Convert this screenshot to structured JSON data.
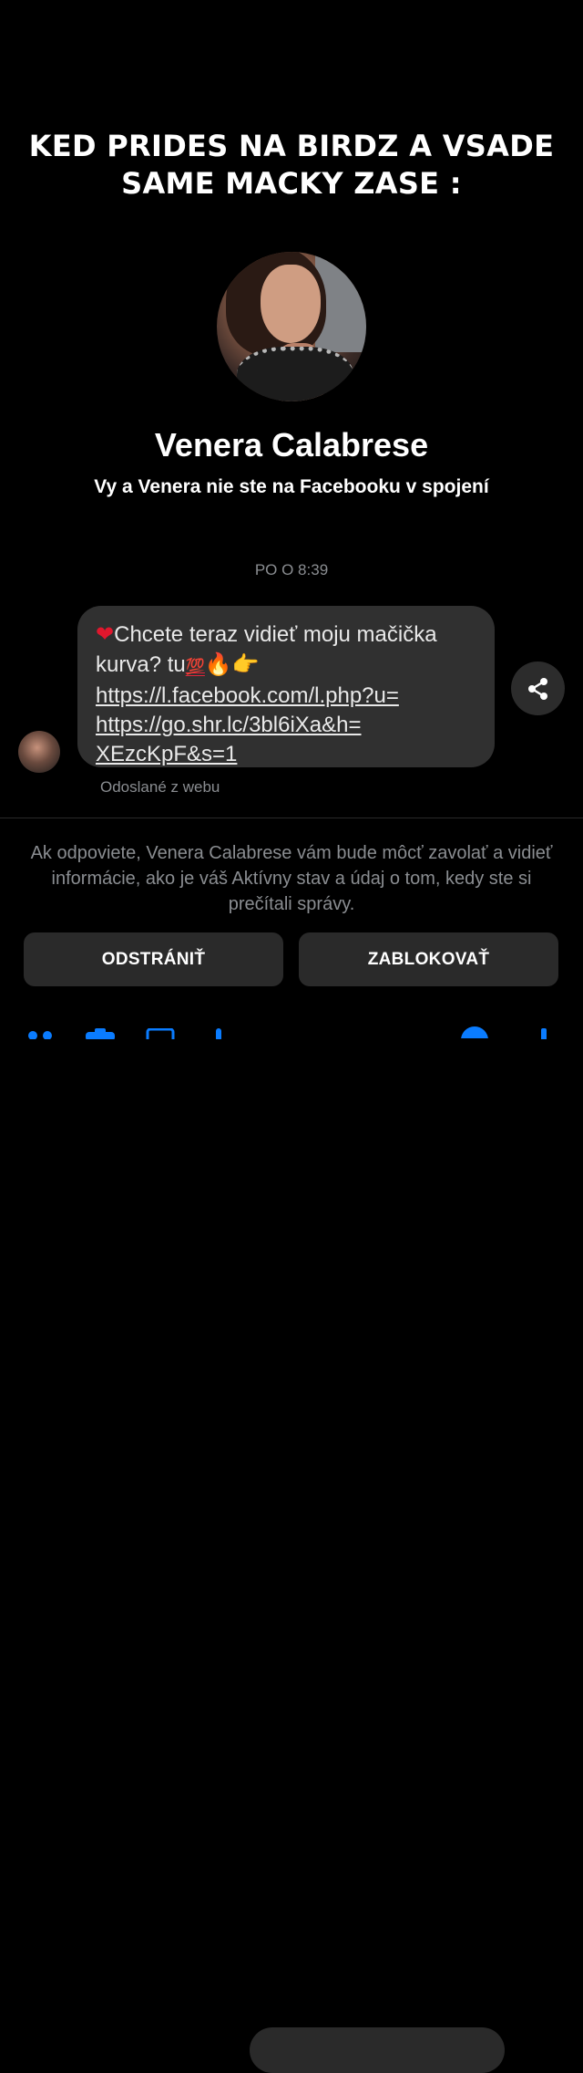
{
  "caption": {
    "line1": "KED PRIDES NA BIRDZ A VSADE",
    "line2": "SAME MACKY ZASE :"
  },
  "profile": {
    "name": "Venera Calabrese",
    "subtitle": "Vy a Venera nie ste na Facebooku v spojení"
  },
  "conversation": {
    "timestamp": "PO O 8:39",
    "message": {
      "heart": "❤",
      "line1_text": "Chcete teraz vidieť moju mačička",
      "line2_text": "kurva? tu",
      "emoji_hundred": "💯",
      "emoji_fire": "🔥",
      "emoji_hand": "👉",
      "link_lines": [
        "https://l.facebook.com/l.php?u=",
        "https://go.shr.lc/3bl6iXa&h=",
        "XEzcKpF&s=1"
      ]
    },
    "sent_from": "Odoslané z webu"
  },
  "notice": "Ak odpoviete, Venera Calabrese vám bude môcť zavolať a vidieť informácie, ako je váš Aktívny stav a údaj o tom, kedy ste si prečítali správy.",
  "actions": {
    "remove_label": "ODSTRÁNIŤ",
    "block_label": "ZABLOKOVAŤ"
  },
  "colors": {
    "background": "#000000",
    "bubble": "#303030",
    "muted_text": "#8a8d91",
    "button_bg": "#2a2a2a",
    "accent": "#0a7cff"
  },
  "icons": [
    "share-icon",
    "apps-icon",
    "camera-icon",
    "gallery-icon",
    "microphone-icon",
    "emoji-icon",
    "like-icon"
  ]
}
